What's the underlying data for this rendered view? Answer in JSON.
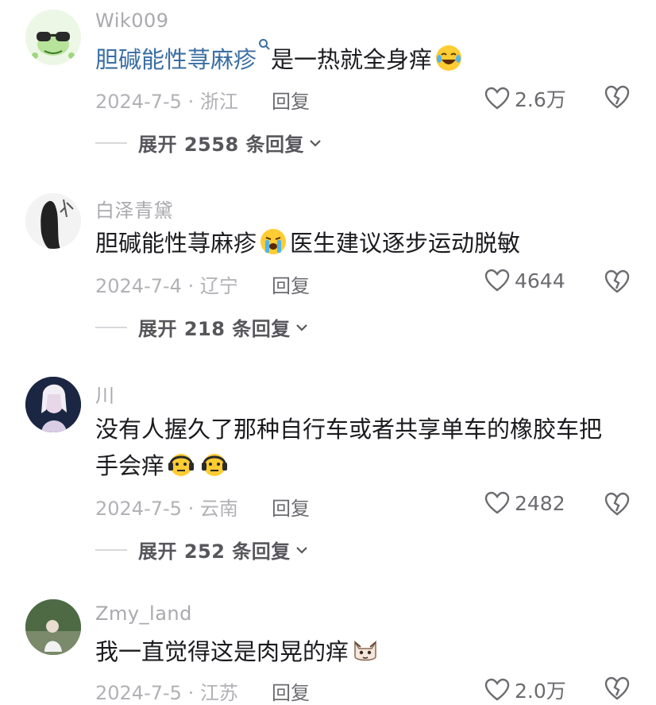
{
  "comments": [
    {
      "username": "Wik009",
      "text_link": "胆碱能性荨麻疹",
      "text_main": "是一热就全身痒",
      "emojis": [
        "laughing-crying-emoji"
      ],
      "date_location": "2024-7-5 · 浙江",
      "reply_label": "回复",
      "likes": "2.6万",
      "expand_label": "展开 2558 条回复"
    },
    {
      "username": "白泽青黛",
      "text_pre": "胆碱能性荨麻疹",
      "text_post": "医生建议逐步运动脱敏",
      "emojis": [
        "crying-emoji"
      ],
      "date_location": "2024-7-4 · 辽宁",
      "reply_label": "回复",
      "likes": "4644",
      "expand_label": "展开 218 条回复"
    },
    {
      "username": "川",
      "text_line1": "没有人握久了那种自行车或者共享单车的橡胶车把",
      "text_line2": "手会痒",
      "emojis": [
        "headphones-emoji",
        "headphones-emoji"
      ],
      "date_location": "2024-7-5 · 云南",
      "reply_label": "回复",
      "likes": "2482",
      "expand_label": "展开 252 条回复"
    },
    {
      "username": "Zmy_land",
      "text_main": "我一直觉得这是肉晃的痒",
      "emojis": [
        "cat-emoji"
      ],
      "date_location": "2024-7-5 · 江苏",
      "reply_label": "回复",
      "likes": "2.0万"
    }
  ],
  "colors": {
    "link": "#3a6ea3",
    "muted": "#b1b1b6",
    "text": "#1b1b1f"
  }
}
